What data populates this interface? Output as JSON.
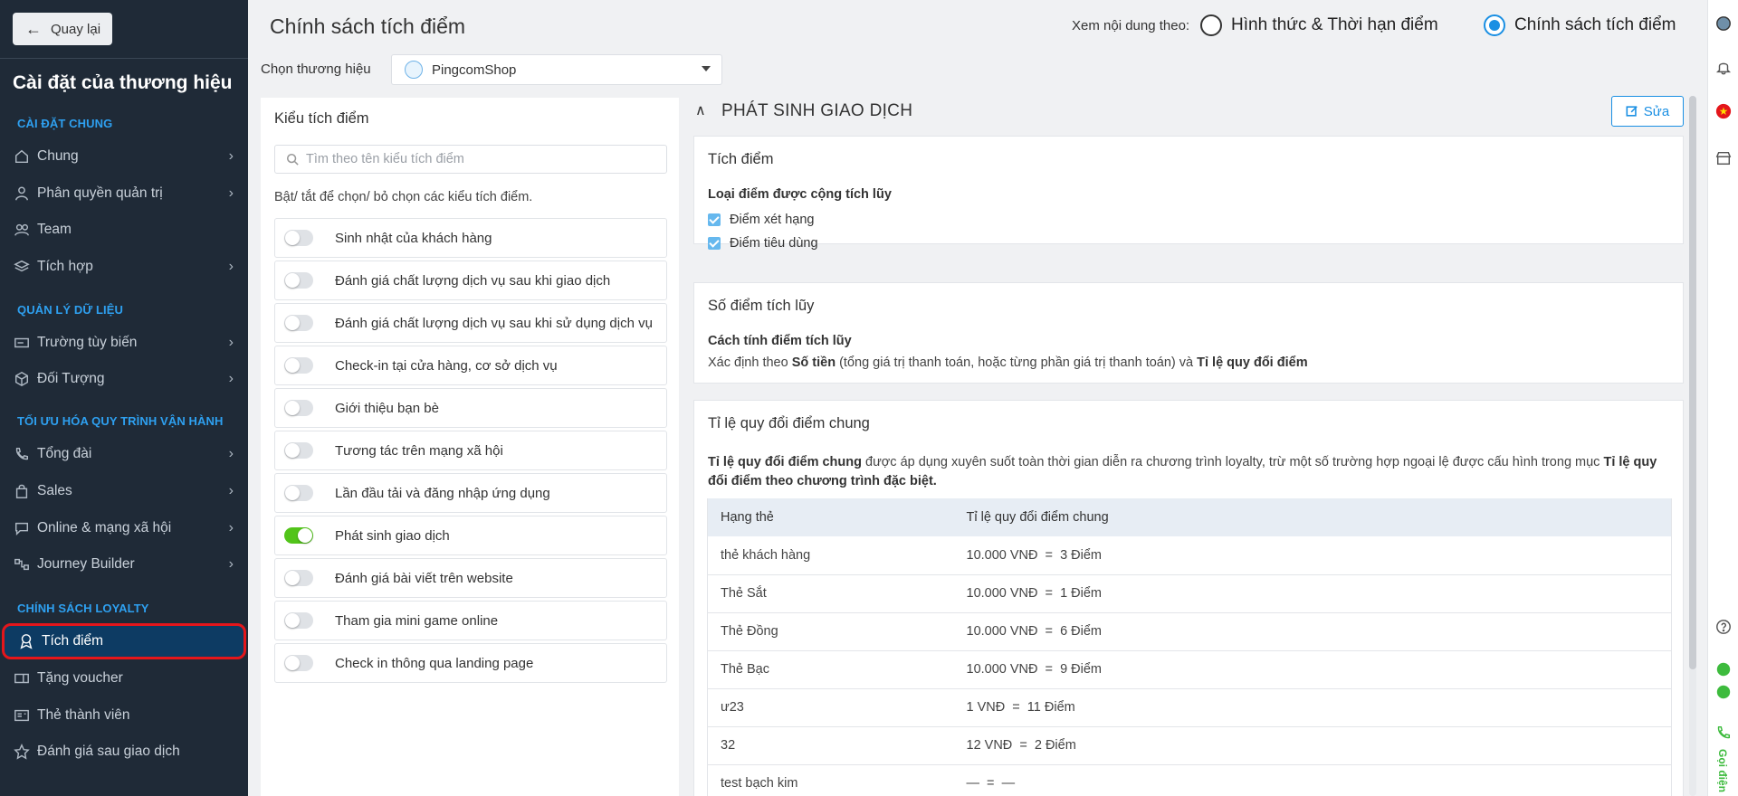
{
  "sidebar": {
    "back_label": "Quay lại",
    "title": "Cài đặt của thương hiệu",
    "sections": {
      "general": "CÀI ĐẶT CHUNG",
      "data": "QUẢN LÝ DỮ LIỆU",
      "optimize": "TỐI ƯU HÓA QUY TRÌNH VẬN HÀNH",
      "loyalty": "CHÍNH SÁCH LOYALTY"
    },
    "items": {
      "chung": "Chung",
      "phan_quyen": "Phân quyền quản trị",
      "team": "Team",
      "tich_hop": "Tích hợp",
      "truong_tuy_bien": "Trường tùy biến",
      "doi_tuong": "Đối Tượng",
      "tong_dai": "Tổng đài",
      "sales": "Sales",
      "online": "Online & mạng xã hội",
      "journey": "Journey Builder",
      "tich_diem": "Tích điểm",
      "tang_voucher": "Tặng voucher",
      "the_thanh_vien": "Thẻ thành viên",
      "danh_gia": "Đánh giá sau giao dịch"
    }
  },
  "header": {
    "title": "Chính sách tích điểm",
    "view_by": "Xem nội dung theo:",
    "option1": "Hình thức & Thời hạn điểm",
    "option2": "Chính sách tích điểm",
    "selected": "Chính sách tích điểm"
  },
  "brand": {
    "label": "Chọn thương hiệu",
    "value": "PingcomShop"
  },
  "left_panel": {
    "title": "Kiểu tích điểm",
    "search_placeholder": "Tìm theo tên kiểu tích điểm",
    "hint": "Bật/ tắt để chọn/ bỏ chọn các kiểu tích điểm.",
    "toggles": [
      {
        "label": "Sinh nhật của khách hàng",
        "on": false
      },
      {
        "label": "Đánh giá chất lượng dịch vụ sau khi giao dịch",
        "on": false
      },
      {
        "label": "Đánh giá chất lượng dịch vụ sau khi sử dụng dịch vụ",
        "on": false
      },
      {
        "label": "Check-in tại cửa hàng, cơ sở dịch vụ",
        "on": false
      },
      {
        "label": "Giới thiệu bạn bè",
        "on": false
      },
      {
        "label": "Tương tác trên mạng xã hội",
        "on": false
      },
      {
        "label": "Lần đầu tải và đăng nhập ứng dụng",
        "on": false
      },
      {
        "label": "Phát sinh giao dịch",
        "on": true
      },
      {
        "label": "Đánh giá bài viết trên website",
        "on": false
      },
      {
        "label": "Tham gia mini game online",
        "on": false
      },
      {
        "label": "Check in thông qua landing page",
        "on": false
      }
    ]
  },
  "main": {
    "section_title": "PHÁT SINH GIAO DỊCH",
    "edit_label": "Sửa",
    "card1": {
      "title": "Tích điểm",
      "subtitle": "Loại điểm được cộng tích lũy",
      "check1": "Điểm xét hạng",
      "check2": "Điểm tiêu dùng"
    },
    "card2": {
      "title": "Số điểm tích lũy",
      "subtitle": "Cách tính điểm tích lũy",
      "desc_prefix": "Xác định theo ",
      "desc_bold1": "Số tiền",
      "desc_mid": " (tổng giá trị thanh toán, hoặc từng phần giá trị thanh toán) và ",
      "desc_bold2": "Tỉ lệ quy đổi điểm"
    },
    "card3": {
      "title": "Tỉ lệ quy đổi điểm chung",
      "desc_bold1": "Tỉ lệ quy đổi điểm chung",
      "desc_mid": " được áp dụng xuyên suốt toàn thời gian diễn ra chương trình loyalty, trừ một số trường hợp ngoại lệ được cấu hình trong mục ",
      "desc_bold2": "Tỉ lệ quy đổi điểm theo chương trình đặc biệt.",
      "col1": "Hạng thẻ",
      "col2": "Tỉ lệ quy đổi điểm chung",
      "rows": [
        {
          "tier": "thẻ khách hàng",
          "rate": "10.000 VNĐ  =  3 Điểm"
        },
        {
          "tier": "Thẻ Sắt",
          "rate": "10.000 VNĐ  =  1 Điểm"
        },
        {
          "tier": "Thẻ Đồng",
          "rate": "10.000 VNĐ  =  6 Điểm"
        },
        {
          "tier": "Thẻ Bạc",
          "rate": "10.000 VNĐ  =  9 Điểm"
        },
        {
          "tier": "ư23",
          "rate": "1 VNĐ  =  11 Điểm"
        },
        {
          "tier": "32",
          "rate": "12 VNĐ  =  2 Điểm"
        },
        {
          "tier": "test bạch kim",
          "rate": "—  =  —"
        }
      ]
    }
  },
  "rail": {
    "call_label": "Gọi điện"
  },
  "colors": {
    "sidebar_bg": "#1f2a37",
    "accent": "#1a8fe3",
    "active_outline": "#e4161b",
    "switch_on": "#52c41a"
  }
}
